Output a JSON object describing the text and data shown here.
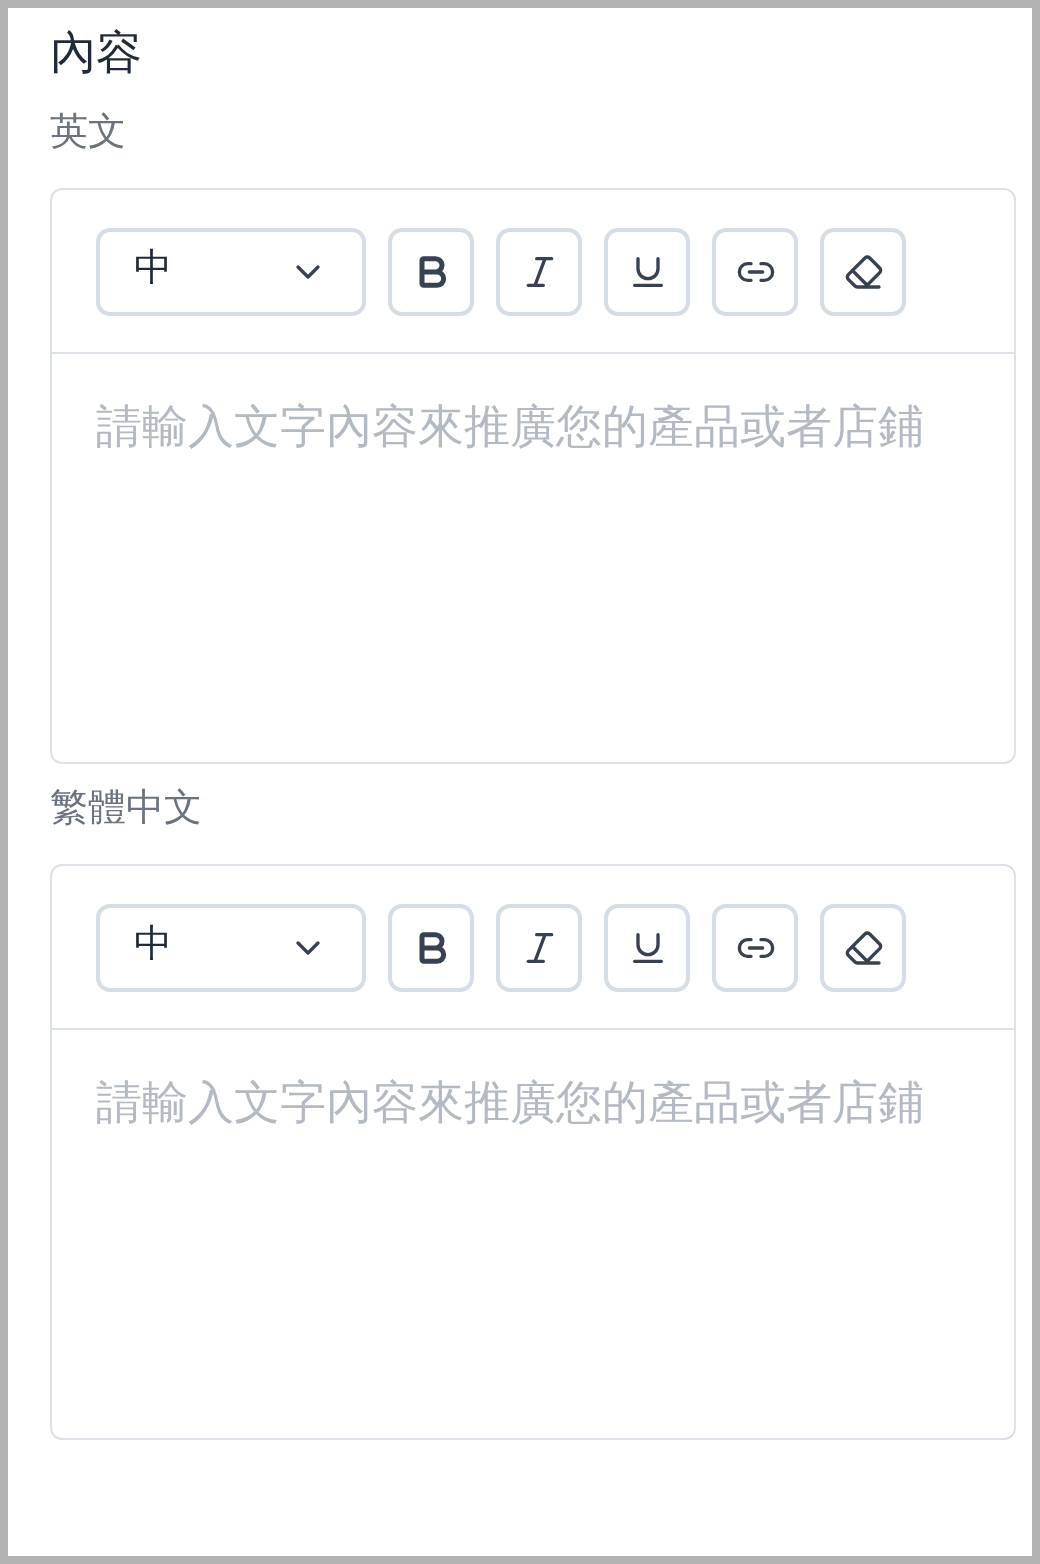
{
  "section_title": "內容",
  "editors": [
    {
      "label": "英文",
      "font_size": "中",
      "placeholder": "請輸入文字內容來推廣您的產品或者店鋪",
      "tools": [
        {
          "kind": "bold"
        },
        {
          "kind": "italic"
        },
        {
          "kind": "underline"
        },
        {
          "kind": "link"
        },
        {
          "kind": "eraser"
        }
      ]
    },
    {
      "label": "繁體中文",
      "font_size": "中",
      "placeholder": "請輸入文字內容來推廣您的產品或者店鋪",
      "tools": [
        {
          "kind": "bold"
        },
        {
          "kind": "italic"
        },
        {
          "kind": "underline"
        },
        {
          "kind": "link"
        },
        {
          "kind": "eraser"
        }
      ]
    }
  ]
}
